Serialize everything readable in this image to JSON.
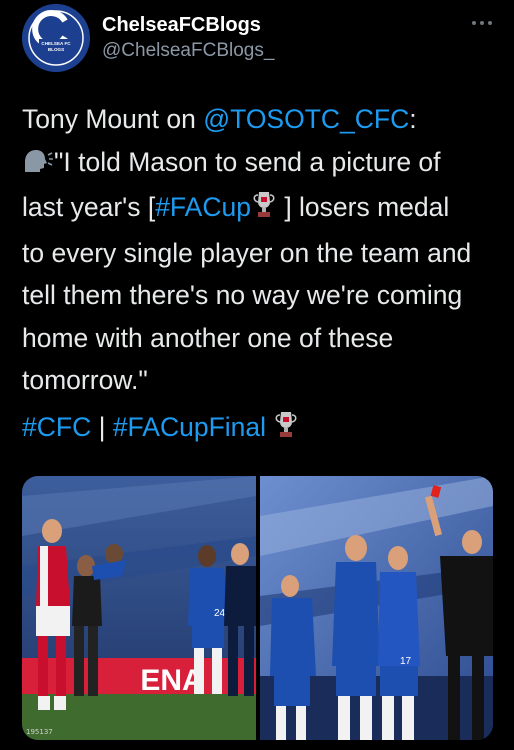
{
  "account": {
    "display_name": "ChelseaFCBlogs",
    "handle": "@ChelseaFCBlogs_",
    "avatar_text_top": "CHELSEA FC",
    "avatar_text_bottom": "BLOGS",
    "avatar_letter": "C"
  },
  "more_icon": "ellipsis-icon",
  "tweet": {
    "line1_prefix": "Tony Mount on ",
    "line1_mention": "@TOSOTC_CFC",
    "line1_suffix": ":",
    "line2_text": "\"I told Mason to send a picture of",
    "line3_prefix": "last year's [",
    "line3_hashtag": "#FACup",
    "line3_suffix": " ] losers medal",
    "line4": "to every single player on the team and",
    "line5": "tell them there's no way we're coming",
    "line6": "home with another one of these",
    "line7": "tomorrow.\"",
    "speaking_emoji": "speaking-head-icon",
    "trophy_emoji": "trophy-icon"
  },
  "hashtags": {
    "first": "#CFC",
    "separator": " | ",
    "second": "#FACupFinal"
  },
  "media": {
    "left_photo_sign_text": "ENA",
    "left_photo_watermark": "195137",
    "left_player_number": "24",
    "right_player_number": "17"
  },
  "colors": {
    "background": "#000000",
    "link": "#1d9bf0",
    "secondary_text": "#8b98a5",
    "chelsea_blue": "#1d4fb0",
    "arsenal_red": "#c8102e"
  }
}
